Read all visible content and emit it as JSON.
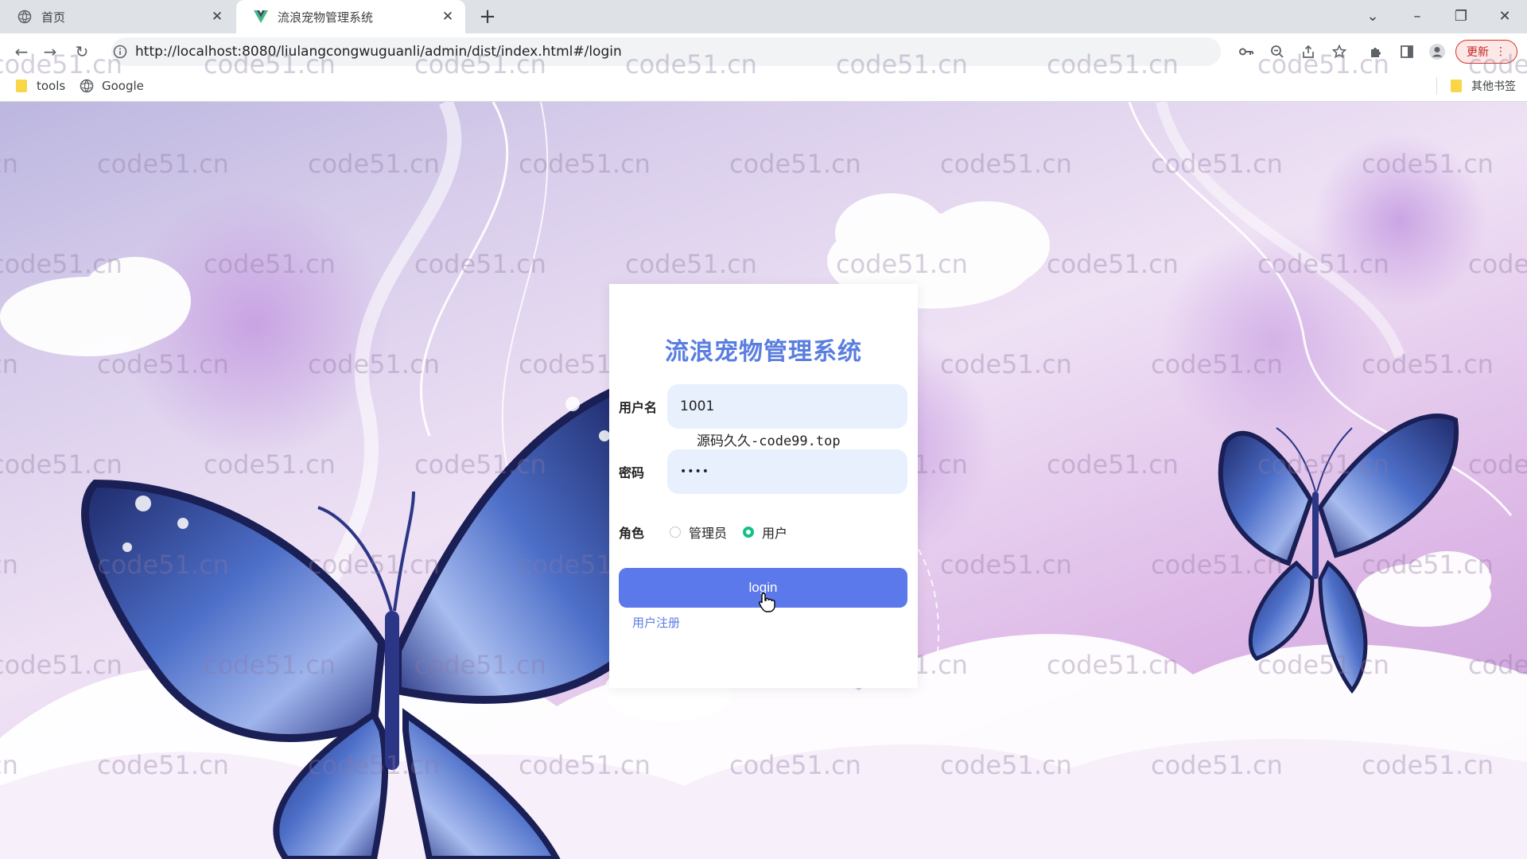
{
  "browser": {
    "tabs": [
      {
        "title": "首页",
        "active": false
      },
      {
        "title": "流浪宠物管理系统",
        "active": true
      }
    ],
    "url": "http://localhost:8080/liulangcongwuguanli/admin/dist/index.html#/login",
    "update_label": "更新",
    "bookmarks": [
      "tools",
      "Google"
    ],
    "other_bookmarks": "其他书签"
  },
  "login": {
    "title": "流浪宠物管理系统",
    "username_label": "用户名",
    "username_value": "1001",
    "password_label": "密码",
    "password_value": "••••",
    "overlay_text": "源码久久-code99.top",
    "role_label": "角色",
    "roles": [
      "管理员",
      "用户"
    ],
    "selected_role": "用户",
    "login_button": "login",
    "register_link": "用户注册"
  },
  "watermark": "code51.cn",
  "colors": {
    "accent": "#5b79ea",
    "title": "#5a7ee0",
    "radio_checked": "#13c089"
  }
}
